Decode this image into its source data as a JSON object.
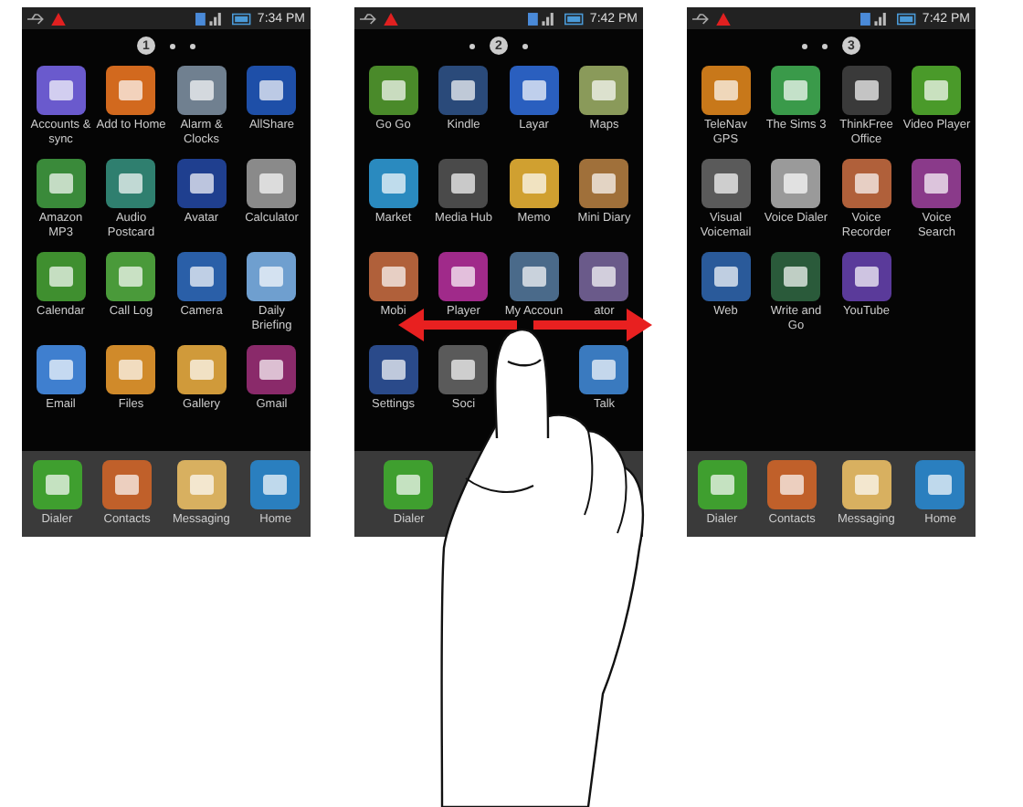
{
  "screens": [
    {
      "time": "7:34 PM",
      "pages": [
        {
          "label": "1",
          "selected": true
        },
        {
          "selected": false
        },
        {
          "selected": false
        }
      ],
      "apps": [
        {
          "label": "Accounts & sync",
          "color": "#6a5acd"
        },
        {
          "label": "Add to Home",
          "color": "#d2691e"
        },
        {
          "label": "Alarm & Clocks",
          "color": "#708090"
        },
        {
          "label": "AllShare",
          "color": "#1e4fa8"
        },
        {
          "label": "Amazon MP3",
          "color": "#3a8a3a"
        },
        {
          "label": "Audio Postcard",
          "color": "#2f7f6f"
        },
        {
          "label": "Avatar",
          "color": "#1f3f8f"
        },
        {
          "label": "Calculator",
          "color": "#8a8a8a"
        },
        {
          "label": "Calendar",
          "color": "#3f8f2f"
        },
        {
          "label": "Call Log",
          "color": "#4a9a3a"
        },
        {
          "label": "Camera",
          "color": "#2a5fa8"
        },
        {
          "label": "Daily Briefing",
          "color": "#6f9fcf"
        },
        {
          "label": "Email",
          "color": "#3f7fcf"
        },
        {
          "label": "Files",
          "color": "#d08a2a"
        },
        {
          "label": "Gallery",
          "color": "#d09a3a"
        },
        {
          "label": "Gmail",
          "color": "#8a2a6a"
        }
      ],
      "dock": [
        {
          "label": "Dialer",
          "color": "#3f9f2f"
        },
        {
          "label": "Contacts",
          "color": "#c0602a"
        },
        {
          "label": "Messaging",
          "color": "#d8b060"
        },
        {
          "label": "Home",
          "color": "#2a7fbf"
        }
      ]
    },
    {
      "time": "7:42 PM",
      "pages": [
        {
          "selected": false
        },
        {
          "label": "2",
          "selected": true
        },
        {
          "selected": false
        }
      ],
      "apps": [
        {
          "label": "Go Go",
          "color": "#4a8a2a"
        },
        {
          "label": "Kindle",
          "color": "#2a4a7a"
        },
        {
          "label": "Layar",
          "color": "#2a5fbf"
        },
        {
          "label": "Maps",
          "color": "#8a9a5a"
        },
        {
          "label": "Market",
          "color": "#2a8abf"
        },
        {
          "label": "Media Hub",
          "color": "#4a4a4a"
        },
        {
          "label": "Memo",
          "color": "#d0a030"
        },
        {
          "label": "Mini Diary",
          "color": "#a0703a"
        },
        {
          "label": "Mobi",
          "color": "#b0603a"
        },
        {
          "label": "Player",
          "color": "#a02a8a"
        },
        {
          "label": "My Accoun",
          "color": "#4a6a8a"
        },
        {
          "label": "ator",
          "color": "#6a5a8a"
        },
        {
          "label": "Settings",
          "color": "#2a4a8a"
        },
        {
          "label": "Soci",
          "color": "#5a5a5a"
        },
        {
          "kind": "covered"
        },
        {
          "label": "Talk",
          "color": "#3a7abf"
        }
      ],
      "dock": [
        {
          "label": "Dialer",
          "color": "#3f9f2f"
        },
        {
          "kind": "covered"
        },
        {
          "kind": "covered"
        },
        {
          "kind": "covered"
        }
      ]
    },
    {
      "time": "7:42 PM",
      "pages": [
        {
          "selected": false
        },
        {
          "selected": false
        },
        {
          "label": "3",
          "selected": true
        }
      ],
      "apps": [
        {
          "label": "TeleNav GPS",
          "color": "#c8781a"
        },
        {
          "label": "The Sims 3",
          "color": "#3a9a4a"
        },
        {
          "label": "ThinkFree Office",
          "color": "#3a3a3a"
        },
        {
          "label": "Video Player",
          "color": "#4a9a2a"
        },
        {
          "label": "Visual Voicemail",
          "color": "#5a5a5a"
        },
        {
          "label": "Voice Dialer",
          "color": "#9a9a9a"
        },
        {
          "label": "Voice Recorder",
          "color": "#b0603a"
        },
        {
          "label": "Voice Search",
          "color": "#8a3a8a"
        },
        {
          "label": "Web",
          "color": "#2a5a9a"
        },
        {
          "label": "Write and Go",
          "color": "#2a5a3a"
        },
        {
          "label": "YouTube",
          "color": "#5a3a9a"
        }
      ],
      "dock": [
        {
          "label": "Dialer",
          "color": "#3f9f2f"
        },
        {
          "label": "Contacts",
          "color": "#c0602a"
        },
        {
          "label": "Messaging",
          "color": "#d8b060"
        },
        {
          "label": "Home",
          "color": "#2a7fbf"
        }
      ]
    }
  ]
}
